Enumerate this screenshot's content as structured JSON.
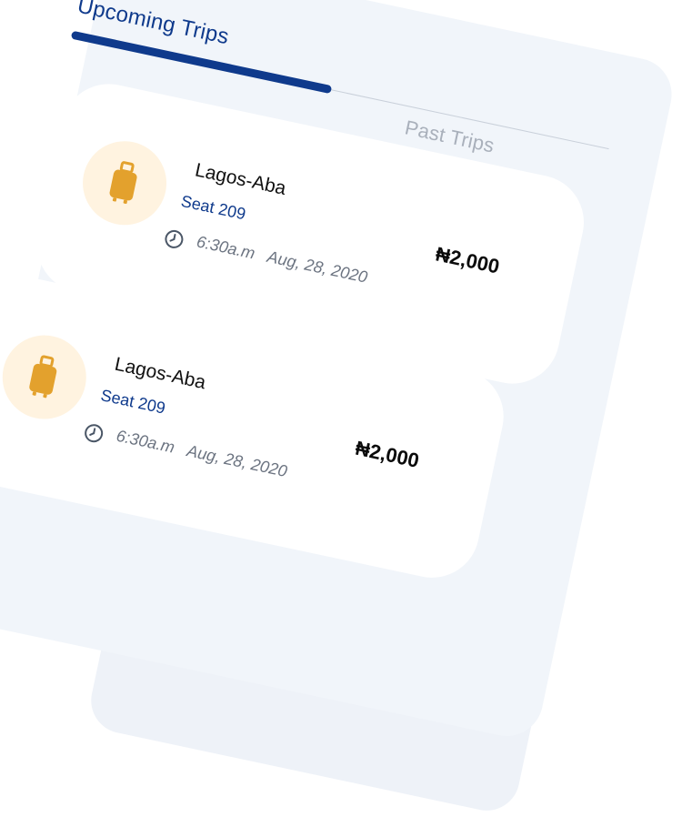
{
  "tabs": {
    "upcoming": "Upcoming Trips",
    "past": "Past Trips"
  },
  "trips": [
    {
      "route": "Lagos-Aba",
      "seat": "Seat 209",
      "time": "6:30a.m",
      "date": "Aug, 28, 2020",
      "price": "₦2,000",
      "icon": "luggage-icon"
    },
    {
      "route": "Lagos-Aba",
      "seat": "Seat 209",
      "time": "6:30a.m",
      "date": "Aug, 28, 2020",
      "price": "₦2,000",
      "icon": "luggage-icon"
    }
  ],
  "colors": {
    "accent": "#0f3a8c",
    "icon_bg": "#fff3e0",
    "icon_fg": "#e3a12d",
    "panel_bg": "#f1f5fa"
  }
}
